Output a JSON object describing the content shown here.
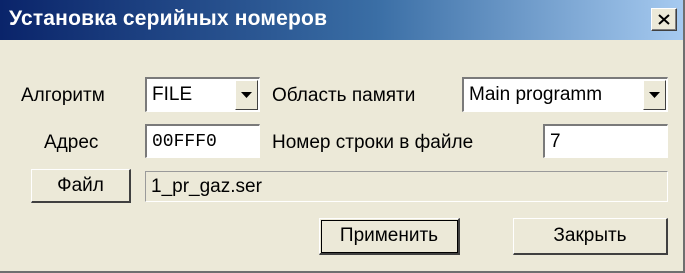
{
  "window": {
    "title": "Установка серийных номеров"
  },
  "form": {
    "algorithm_label": "Алгоритм",
    "algorithm_value": "FILE",
    "memory_label": "Область памяти",
    "memory_value": "Main programm",
    "address_label": "Адрес",
    "address_value": "00FFF0",
    "line_label": "Номер строки в файле",
    "line_value": "7",
    "file_button": "Файл",
    "file_path": "1_pr_gaz.ser"
  },
  "buttons": {
    "apply": "Применить",
    "close": "Закрыть"
  },
  "icons": {
    "close": "close-icon",
    "dropdown": "chevron-down-icon"
  }
}
